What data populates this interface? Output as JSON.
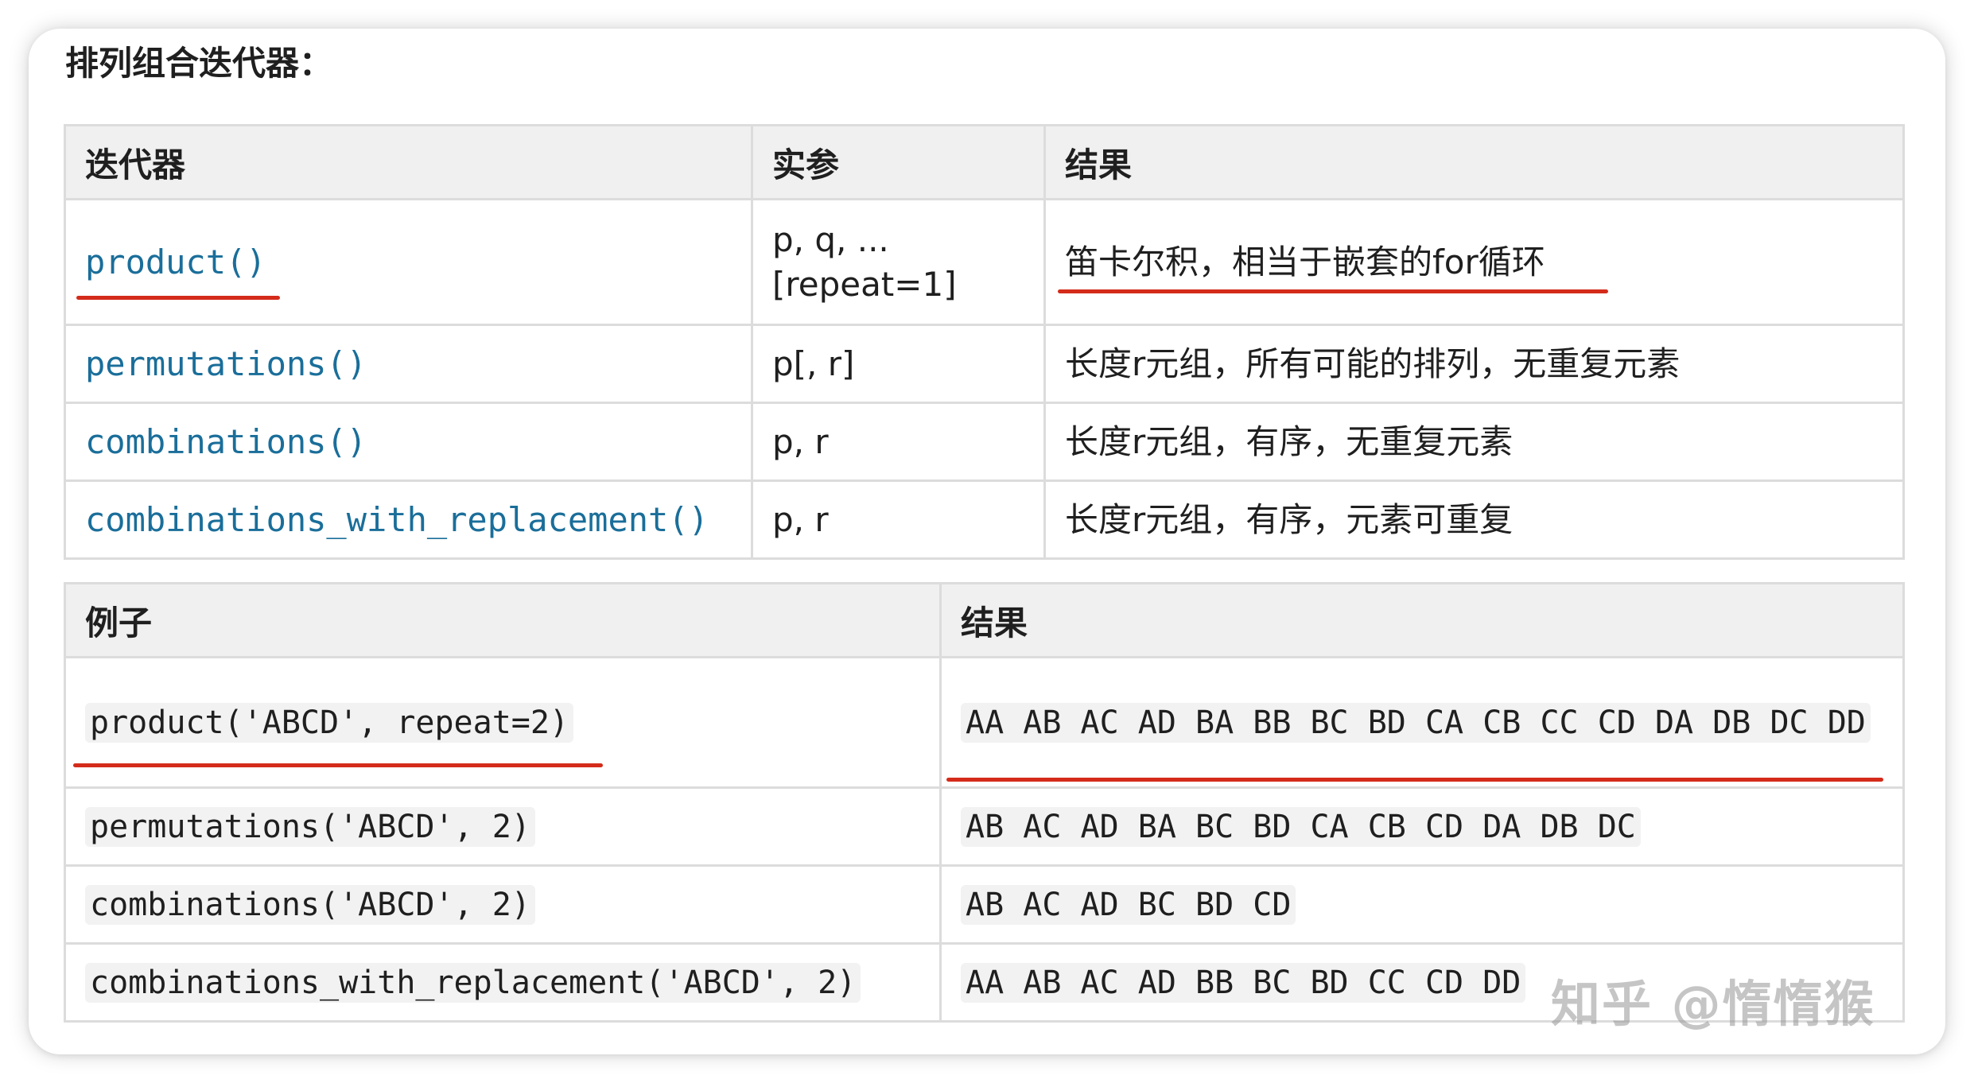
{
  "section_title": "排列组合迭代器：",
  "table1": {
    "headers": [
      "迭代器",
      "实参",
      "结果"
    ],
    "rows": [
      {
        "iterator": "product()",
        "args_line1": "p, q, ...",
        "args_line2": "[repeat=1]",
        "result": "笛卡尔积，相当于嵌套的for循环"
      },
      {
        "iterator": "permutations()",
        "args_line1": "p[, r]",
        "args_line2": "",
        "result": "长度r元组，所有可能的排列，无重复元素"
      },
      {
        "iterator": "combinations()",
        "args_line1": "p, r",
        "args_line2": "",
        "result": "长度r元组，有序，无重复元素"
      },
      {
        "iterator": "combinations_with_replacement()",
        "args_line1": "p, r",
        "args_line2": "",
        "result": "长度r元组，有序，元素可重复"
      }
    ]
  },
  "table2": {
    "headers": [
      "例子",
      "结果"
    ],
    "rows": [
      {
        "example": "product('ABCD', repeat=2)",
        "result": "AA AB AC AD BA BB BC BD CA CB CC CD DA DB DC DD"
      },
      {
        "example": "permutations('ABCD', 2)",
        "result": "AB AC AD BA BC BD CA CB CD DA DB DC"
      },
      {
        "example": "combinations('ABCD', 2)",
        "result": "AB AC AD BC BD CD"
      },
      {
        "example": "combinations_with_replacement('ABCD', 2)",
        "result": "AA AB AC AD BB BC BD CC CD DD"
      }
    ]
  },
  "watermark": "知乎 @惰惰猴",
  "colors": {
    "function_link": "#1a6e9a",
    "underline": "#d42b1a",
    "header_bg": "#f0f0f0"
  }
}
